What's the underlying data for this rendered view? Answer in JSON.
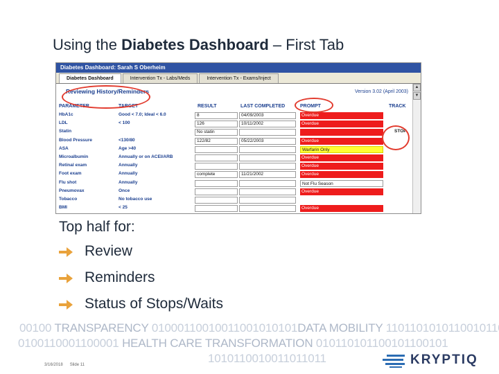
{
  "slide": {
    "title_prefix": "Using the ",
    "title_bold": "Diabetes Dashboard",
    "title_suffix": " – First Tab"
  },
  "screenshot": {
    "window_title": "Diabetes Dashboard:  Sarah S Oberheim",
    "tabs": [
      "Diabetes Dashboard",
      "Intervention Tx - Labs/Meds",
      "Intervention Tx - Exams/Inject"
    ],
    "section_heading": "Reviewing History/Reminders",
    "version": "Version 3.02 (April 2003)",
    "columns": [
      "PARAMETER",
      "TARGET",
      "RESULT",
      "LAST COMPLETED",
      "PROMPT",
      "TRACK"
    ],
    "rows": [
      {
        "parameter": "HbA1c",
        "target": "Good < 7.0; Ideal < 6.0",
        "result": "8",
        "last": "04/09/2003",
        "prompt": "Overdue",
        "prompt_color": "red",
        "track": ""
      },
      {
        "parameter": "LDL",
        "target": "< 100",
        "result": "126",
        "last": "10/11/2002",
        "prompt": "Overdue",
        "prompt_color": "red",
        "track": ""
      },
      {
        "parameter": "Statin",
        "target": "",
        "result": "No statin",
        "last": "",
        "prompt": "",
        "prompt_color": "red",
        "track": "STOP"
      },
      {
        "parameter": "Blood Pressure",
        "target": "<130/80",
        "result": "122/82",
        "last": "05/22/2003",
        "prompt": "Overdue",
        "prompt_color": "red",
        "track": ""
      },
      {
        "parameter": "ASA",
        "target": "Age >40",
        "result": "",
        "last": "",
        "prompt": "Warfarin Only",
        "prompt_color": "yellow",
        "track": ""
      },
      {
        "parameter": "Microalbumin",
        "target": "Annually or on ACEI/ARB",
        "result": "",
        "last": "",
        "prompt": "Overdue",
        "prompt_color": "red",
        "track": ""
      },
      {
        "parameter": "Retinal exam",
        "target": "Annually",
        "result": "",
        "last": "",
        "prompt": "Overdue",
        "prompt_color": "red",
        "track": ""
      },
      {
        "parameter": "Foot exam",
        "target": "Annually",
        "result": "complete",
        "last": "11/21/2002",
        "prompt": "Overdue",
        "prompt_color": "red",
        "track": ""
      },
      {
        "parameter": "Flu shot",
        "target": "Annually",
        "result": "",
        "last": "",
        "prompt": "Not Flu Season",
        "prompt_color": "white",
        "track": ""
      },
      {
        "parameter": "Pneumovax",
        "target": "Once",
        "result": "",
        "last": "",
        "prompt": "Overdue",
        "prompt_color": "red",
        "track": ""
      },
      {
        "parameter": "Tobacco",
        "target": "No tobacco use",
        "result": "",
        "last": "",
        "prompt": "",
        "prompt_color": "none",
        "track": ""
      },
      {
        "parameter": "BMI",
        "target": "< 25",
        "result": "",
        "last": "",
        "prompt": "Overdue",
        "prompt_color": "red",
        "track": ""
      }
    ]
  },
  "body": {
    "intro": "Top half for:",
    "bullets": [
      "Review",
      "Reminders",
      "Status of Stops/Waits"
    ],
    "bullet_icon": "arrow-right-icon"
  },
  "banner": {
    "line1_a": "00100 ",
    "line1_hl": "TRANSPARENCY",
    "line1_b": " 01000110010011001010101",
    "line1_hl2": "DATA MOBILITY",
    "line1_c": " 1101101010110010110",
    "line2_a": "0100110001100001 ",
    "line2_hl": "HEALTH CARE TRANSFORMATION",
    "line2_b": " 010110101100101100101",
    "line3": "1010110010011011011"
  },
  "footer": {
    "date": "3/16/2018",
    "slide_label": "Slide 11"
  },
  "logo": {
    "text": "KRYPTIQ",
    "color": "#2b3b63"
  },
  "colors": {
    "prompt_red": "#ee1c1c",
    "prompt_yellow": "#fffc33",
    "highlight_circle": "#e23b2e",
    "bullet_arrow": "#e9a23b"
  }
}
